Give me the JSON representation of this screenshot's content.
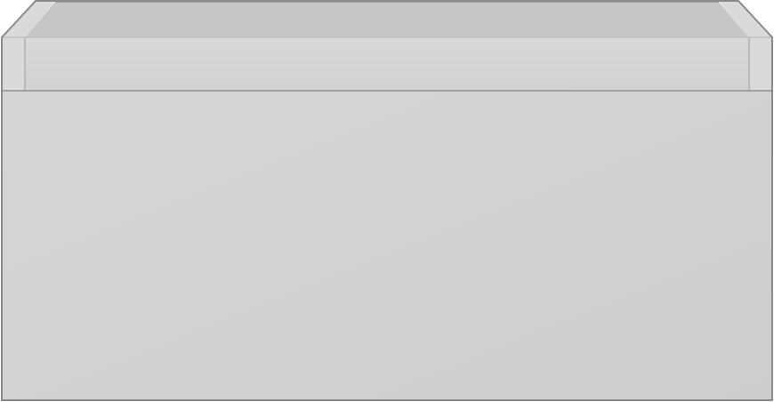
{
  "image": {
    "subject": "drawer-cabinet-render",
    "colors": {
      "background": "#ffffff",
      "front_panel": "#cdcdcb",
      "front_panel_highlight": "#d6d6d4",
      "top_rail": "#d2d2d0",
      "interior_back": "#c6c6c4",
      "side_edge": "#dadad8",
      "edge_line": "#9c9c9a",
      "outline": "#8a8a88"
    }
  }
}
